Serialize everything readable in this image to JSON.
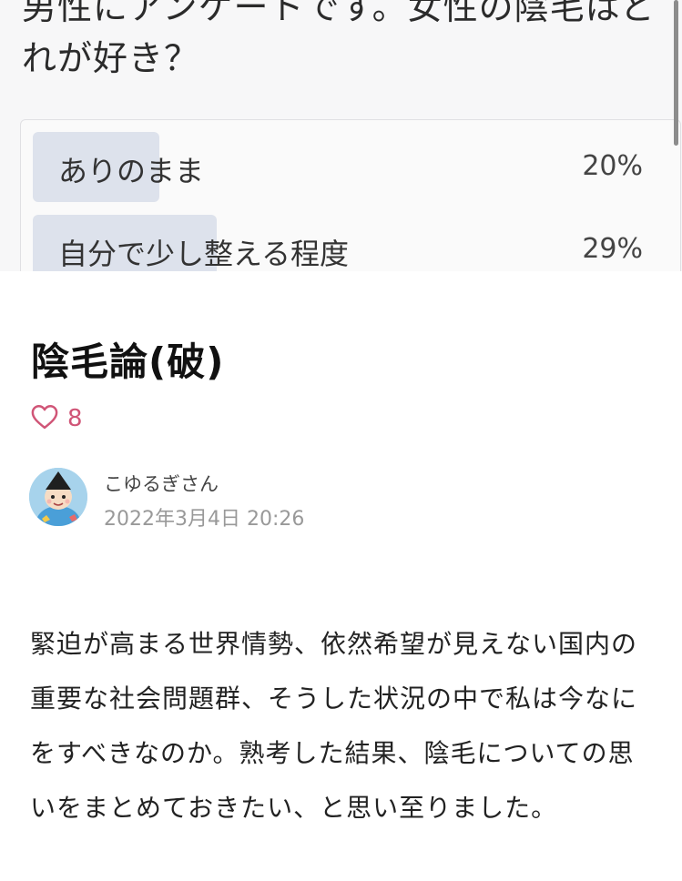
{
  "poll": {
    "question": "男性にアンケートです。女性の陰毛はどれが好き？",
    "options": [
      {
        "label": "ありのまま",
        "percent": "20%",
        "fill": 0.2
      },
      {
        "label": "自分で少し整える程度",
        "percent": "29%",
        "fill": 0.29
      }
    ]
  },
  "article": {
    "title": "陰毛論(破)",
    "likes": "8",
    "author": "こゆるぎさん",
    "date": "2022年3月4日 20:26",
    "body": "緊迫が高まる世界情勢、依然希望が見えない国内の重要な社会問題群、そうした状況の中で私は今なにをすべきなのか。熟考した結果、陰毛についての思いをまとめておきたい、と思い至りました。"
  },
  "colors": {
    "like_accent": "#d05577",
    "poll_bar": "#dde2ec"
  },
  "icons": {
    "like": "heart-icon",
    "avatar": "avatar-illustration"
  }
}
